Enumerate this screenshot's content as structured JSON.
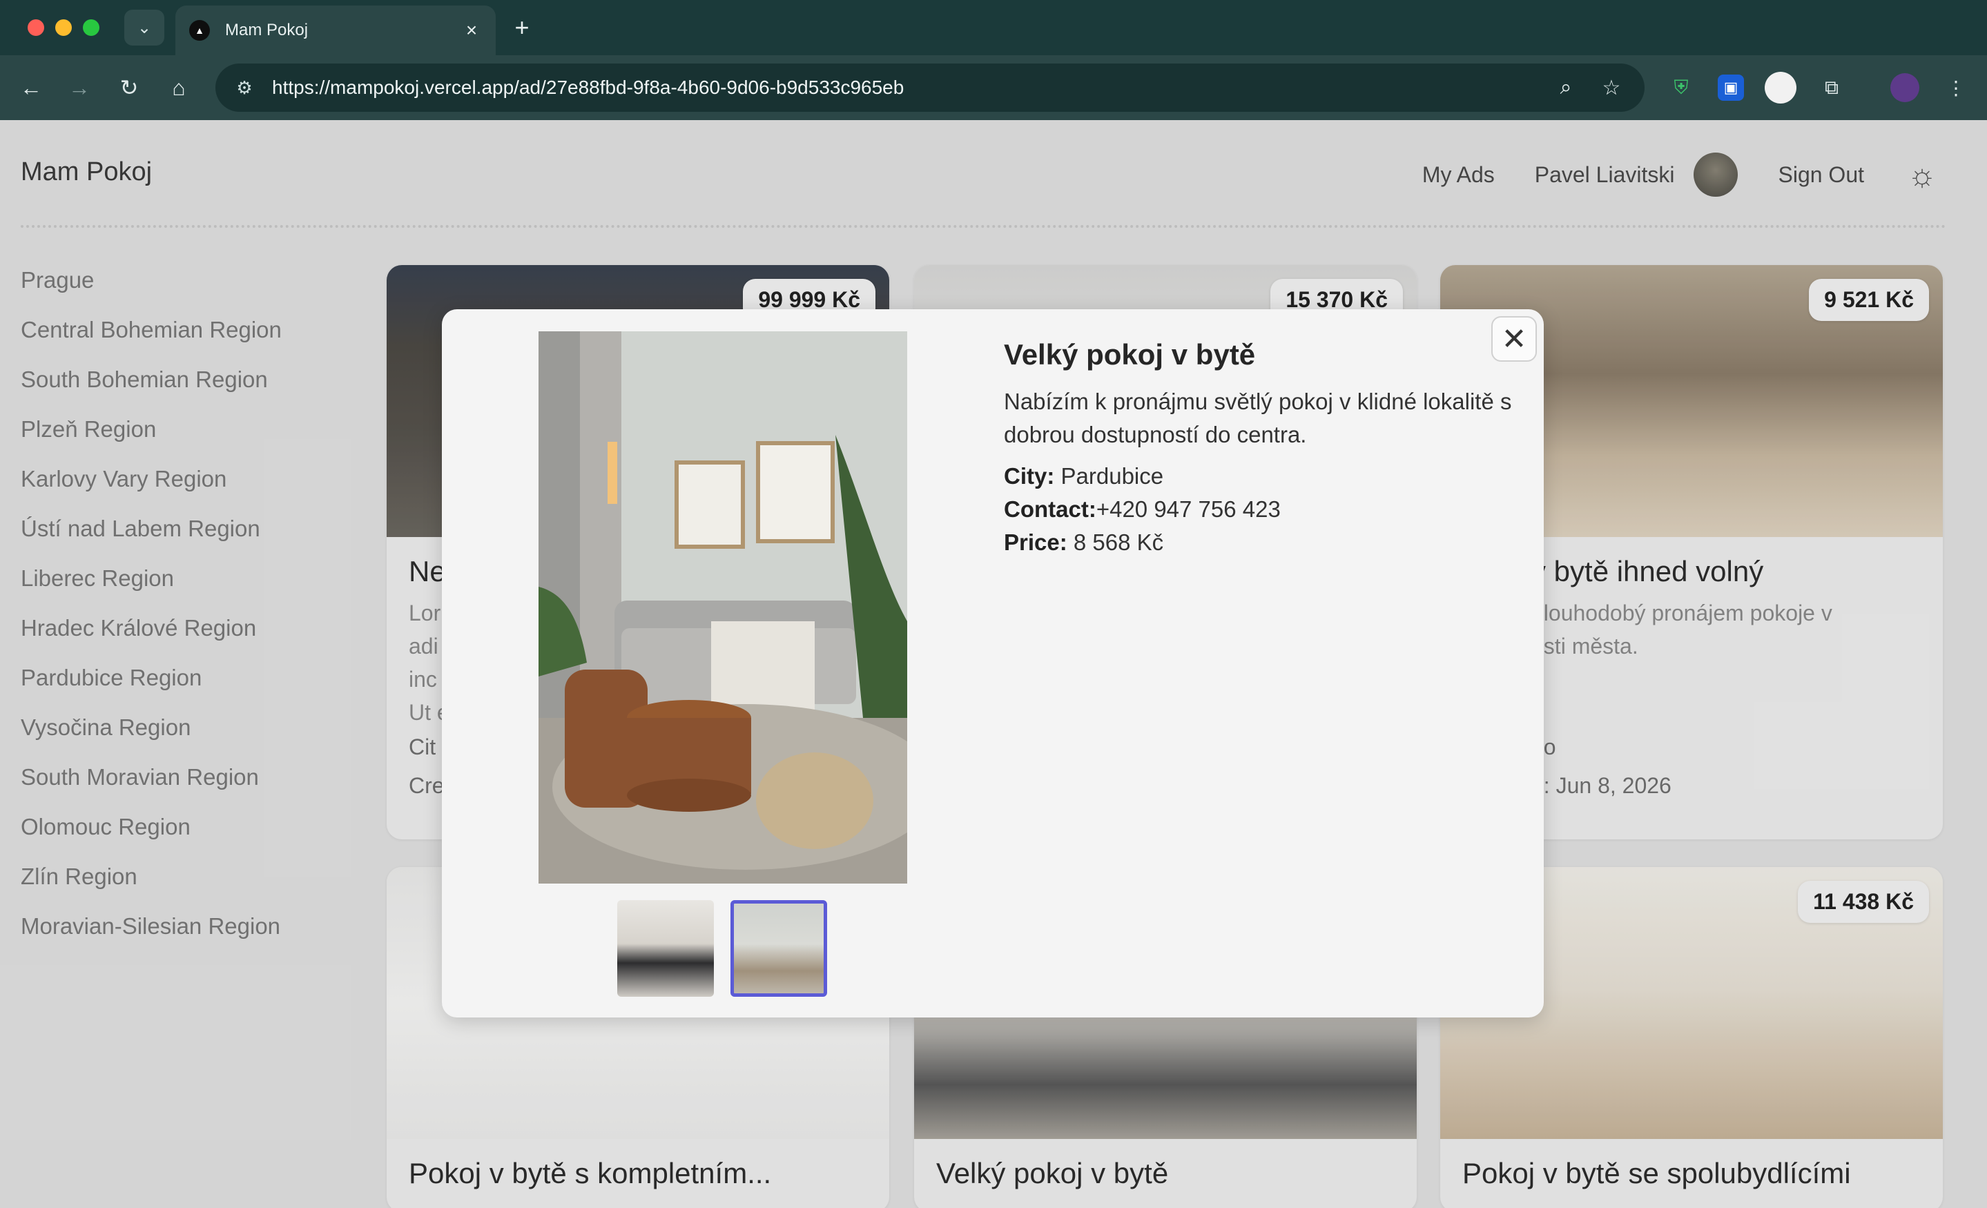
{
  "browser": {
    "tab_title": "Mam Pokoj",
    "tab_favicon": "▲",
    "url": "https://mampokoj.vercel.app/ad/27e88fbd-9f8a-4b60-9d06-b9d533c965eb"
  },
  "header": {
    "logo": "Mam Pokoj",
    "nav": {
      "my_ads": "My Ads",
      "user_name": "Pavel Liavitski",
      "sign_out": "Sign Out"
    }
  },
  "sidebar": {
    "regions": [
      "Prague",
      "Central Bohemian Region",
      "South Bohemian Region",
      "Plzeň Region",
      "Karlovy Vary Region",
      "Ústí nad Labem Region",
      "Liberec Region",
      "Hradec Králové Region",
      "Pardubice Region",
      "Vysočina Region",
      "South Moravian Region",
      "Olomouc Region",
      "Zlín Region",
      "Moravian-Silesian Region"
    ]
  },
  "listings": [
    {
      "price": "99 999 Kč",
      "title": "Ne",
      "desc": "Lor\nadi\ninc\nUt e",
      "meta1": "Cit",
      "meta2": "Cre"
    },
    {
      "price": "15 370 Kč",
      "title": "",
      "desc": "",
      "meta1": "",
      "meta2": ""
    },
    {
      "price": "9 521 Kč",
      "title": "v bytě ihned volný",
      "desc": "dlouhodobý pronájem pokoje v\násti města.",
      "meta1": "no",
      "meta2": "d: Jun 8, 2026"
    },
    {
      "price": "",
      "title": "Pokoj v bytě s kompletním...",
      "desc": "",
      "meta1": "",
      "meta2": ""
    },
    {
      "price": "",
      "title": "Velký pokoj v bytě",
      "desc": "",
      "meta1": "",
      "meta2": ""
    },
    {
      "price": "11 438 Kč",
      "title": "Pokoj v bytě se spolubydlícími",
      "desc": "",
      "meta1": "",
      "meta2": ""
    }
  ],
  "modal": {
    "title": "Velký pokoj v bytě",
    "description": "Nabízím k pronájmu světlý pokoj v klidné lokalitě s dobrou dostupností do centra.",
    "city_label": "City:",
    "city": "Pardubice",
    "contact_label": "Contact:",
    "contact": "+420 947 756 423",
    "price_label": "Price:",
    "price": "8 568 Kč",
    "selected_thumbnail": 2,
    "close_icon": "close-icon"
  },
  "colors": {
    "thumbnail_selected_border": "#5b5bd6",
    "chrome_background": "#2b4747"
  }
}
